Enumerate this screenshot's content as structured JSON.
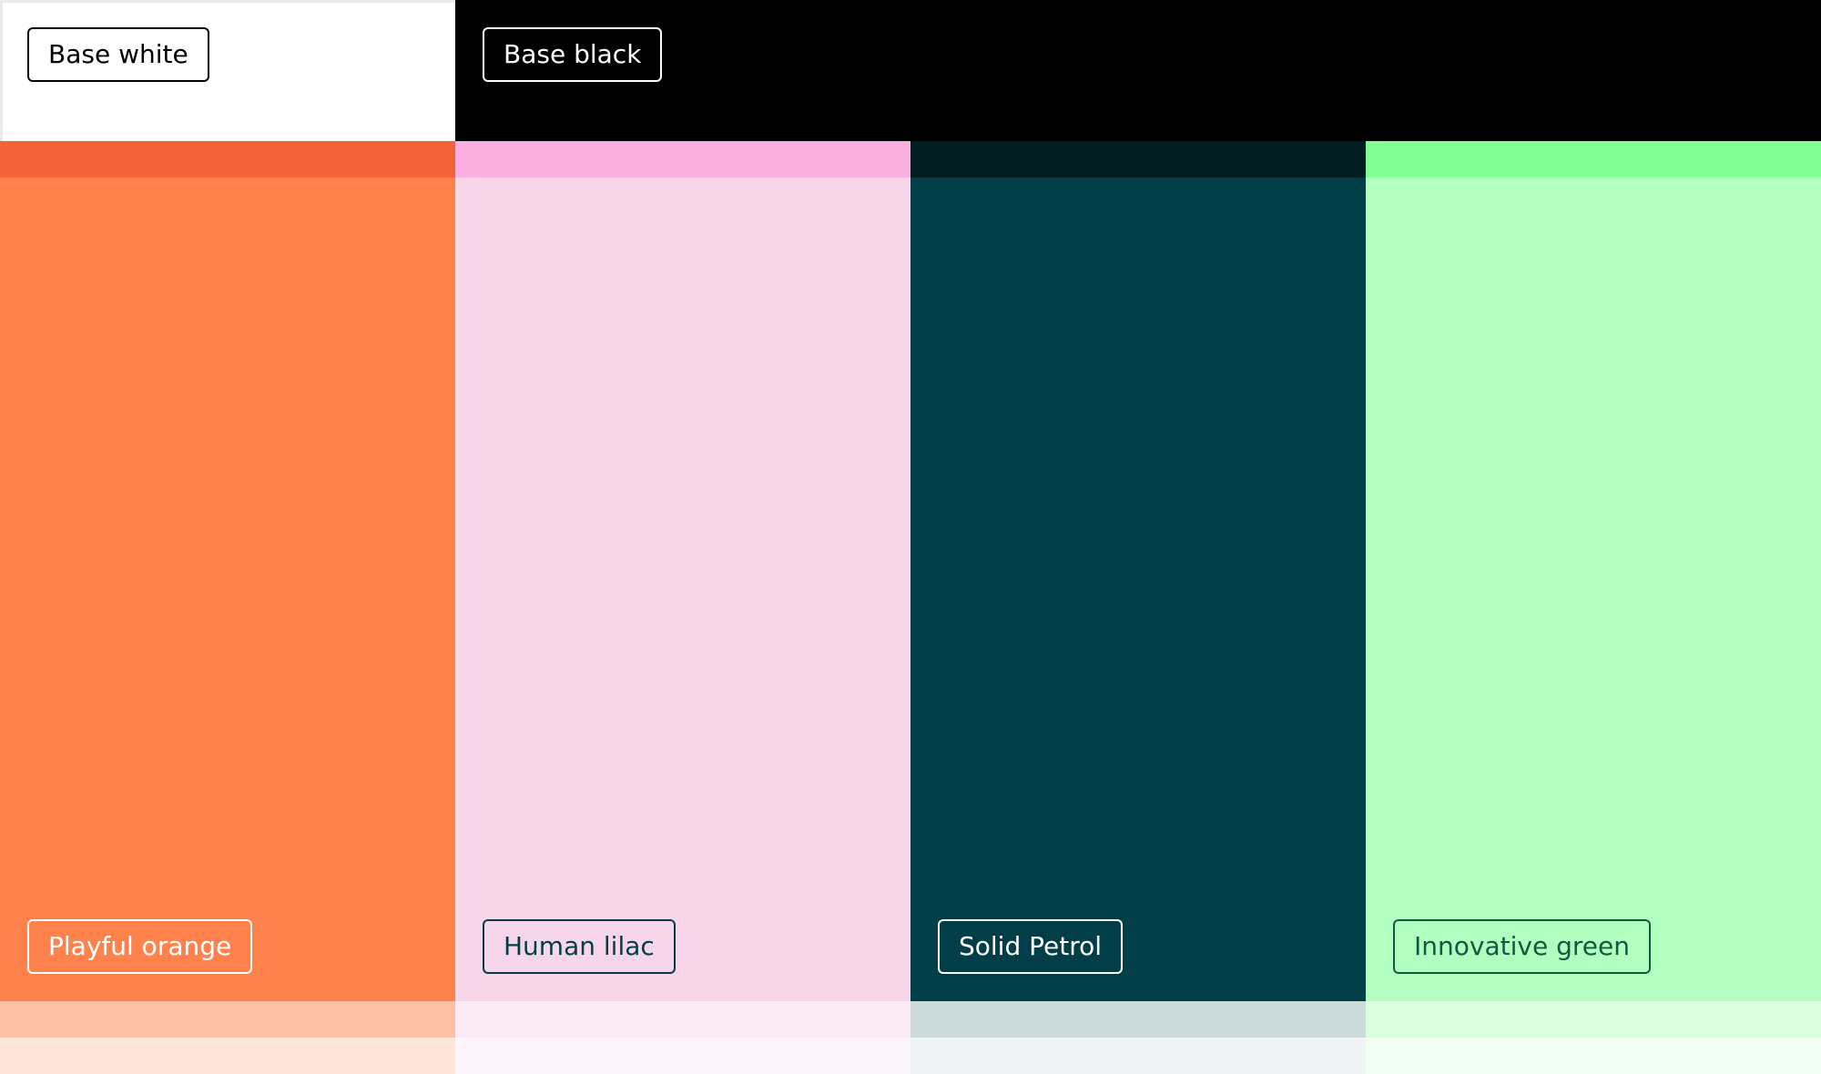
{
  "swatches": {
    "base_white": {
      "label": "Base white",
      "color": "#ffffff",
      "text_color": "#000000"
    },
    "base_black": {
      "label": "Base black",
      "color": "#000000",
      "text_color": "#ffffff"
    },
    "playful_orange": {
      "label": "Playful orange",
      "color": "#ff824c",
      "dark_tint": "#f46237",
      "tint_1": "#ffc1a5",
      "tint_2": "#ffe5d9",
      "text_color": "#ffffff"
    },
    "human_lilac": {
      "label": "Human lilac",
      "color": "#f8d6ea",
      "dark_tint": "#f9b0e0",
      "tint_1": "#fbebf4",
      "tint_2": "#fcf6fa",
      "text_color": "#023f47"
    },
    "solid_petrol": {
      "label": "Solid Petrol",
      "color": "#023e47",
      "dark_tint": "#021e20",
      "tint_1": "#ccdcdd",
      "tint_2": "#f0f4f4",
      "text_color": "#ffffff"
    },
    "innovative_green": {
      "label": "Innovative green",
      "color": "#b3ffc0",
      "dark_tint": "#80fd94",
      "tint_1": "#d9ffdf",
      "tint_2": "#f0fff2",
      "text_color": "#0d5b41"
    }
  }
}
